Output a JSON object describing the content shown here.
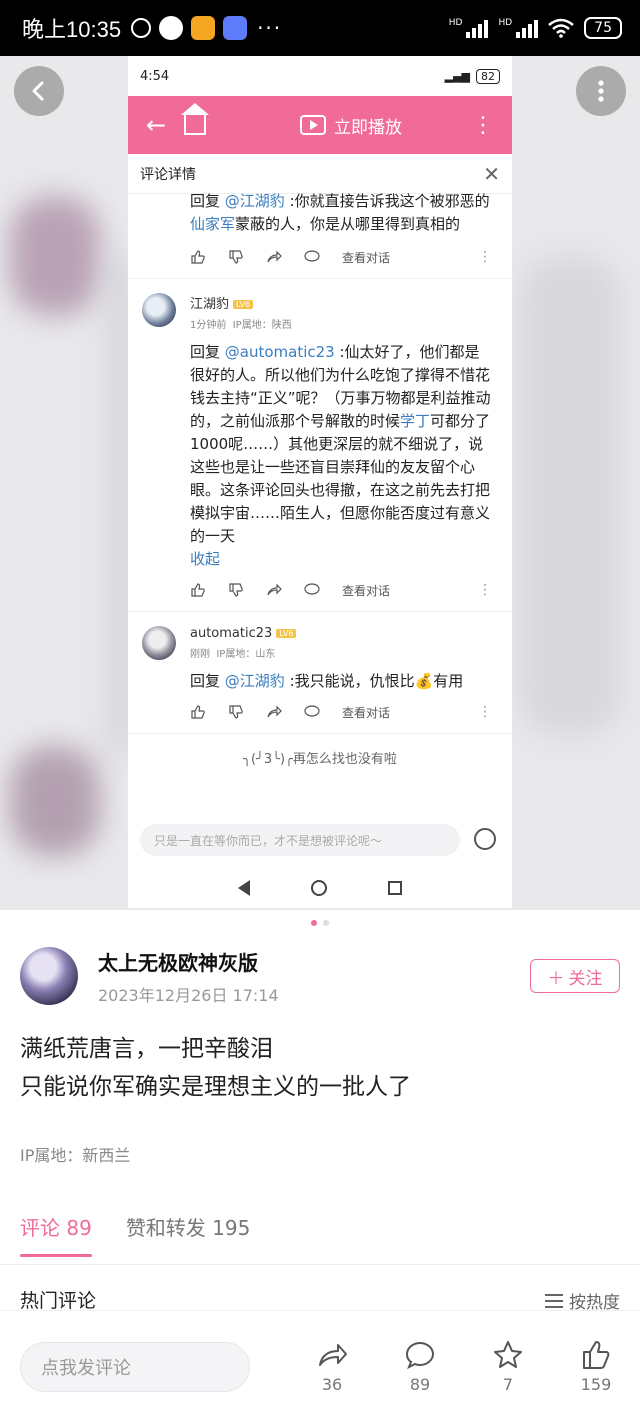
{
  "status_bar": {
    "time": "晚上10:35",
    "more": "···",
    "hd1": "HD",
    "hd2": "HD",
    "battery": "75"
  },
  "inner": {
    "time": "4:54",
    "battery": "82",
    "play_label": "立即播放",
    "detail_title": "评论详情",
    "comment1": {
      "reply_prefix": "回复 ",
      "mention": "@江湖豹",
      "text_a": " :你就直接告诉我这个被邪恶的",
      "link": "仙家军",
      "text_b": "蒙蔽的人，你是从哪里得到真相的"
    },
    "view_conversation": "查看对话",
    "comment2": {
      "user": "江湖豹",
      "level": "LV6",
      "time": "1分钟前",
      "ip": "IP属地：陕西",
      "reply_prefix": "回复 ",
      "mention": "@automatic23",
      "text_a": " :仙太好了，他们都是很好的人。所以他们为什么吃饱了撑得不惜花钱去主持“正义”呢？（万事万物都是利益推动的，之前仙派那个号解散的时候",
      "link": "学丁",
      "text_b": "可都分了1000呢……）其他更深层的就不细说了，说这些也是让一些还盲目崇拜仙的友友留个心眼。这条评论回头也得撤，在这之前先去打把模拟宇宙……陌生人，但愿你能否度过有意义的一天",
      "collapse": "收起"
    },
    "comment3": {
      "user": "automatic23",
      "level": "LV6",
      "time": "刚刚",
      "ip": "IP属地：山东",
      "reply_prefix": "回复 ",
      "mention": "@江湖豹",
      "text": " :我只能说，仇恨比💰有用"
    },
    "end_text": "╮(╯3╰)╭再怎么找也没有啦",
    "input_placeholder": "只是一直在等你而已，才不是想被评论呢～"
  },
  "post": {
    "author": "太上无极欧神灰版",
    "date": "2023年12月26日 17:14",
    "follow": "关注",
    "line1": "满纸荒唐言，一把辛酸泪",
    "line2": "只能说你军确实是理想主义的一批人了",
    "ip": "IP属地：新西兰"
  },
  "tabs": [
    {
      "label": "评论 89"
    },
    {
      "label": "赞和转发 195"
    }
  ],
  "hot_comments": "热门评论",
  "sort_label": "按热度",
  "bottom": {
    "placeholder": "点我发评论",
    "share": "36",
    "comment": "89",
    "favorite": "7",
    "like": "159"
  },
  "colors": {
    "accent": "#f16b99",
    "link": "#3a7dc0"
  }
}
